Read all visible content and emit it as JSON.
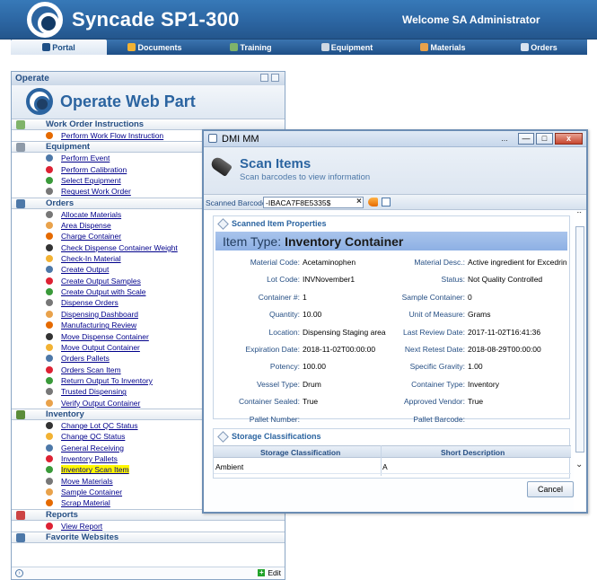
{
  "header": {
    "app_title": "Syncade SP1-300",
    "welcome": "Welcome SA Administrator"
  },
  "nav": {
    "items": [
      {
        "label": "Portal",
        "icon": "portal-icon",
        "color": "#1e4f86"
      },
      {
        "label": "Documents",
        "icon": "folder-icon",
        "color": "#f2b233"
      },
      {
        "label": "Training",
        "icon": "training-icon",
        "color": "#7fb36a"
      },
      {
        "label": "Equipment",
        "icon": "gear-icon",
        "color": "#cfd8e3"
      },
      {
        "label": "Materials",
        "icon": "materials-icon",
        "color": "#e9a24b"
      },
      {
        "label": "Orders",
        "icon": "orders-icon",
        "color": "#d9e3f0"
      }
    ]
  },
  "webpart": {
    "title": "Operate",
    "banner": "Operate Web Part",
    "sections": [
      {
        "title": "Work Order Instructions",
        "items": [
          "Perform Work Flow Instruction"
        ]
      },
      {
        "title": "Equipment",
        "items": [
          "Perform Event",
          "Perform Calibration",
          "Select Equipment",
          "Request Work Order"
        ]
      },
      {
        "title": "Orders",
        "items": [
          "Allocate Materials",
          "Area Dispense",
          "Charge Container",
          "Check Dispense Container Weight",
          "Check-In Material",
          "Create Output",
          "Create Output Samples",
          "Create Output with Scale",
          "Dispense Orders",
          "Dispensing Dashboard",
          "Manufacturing Review",
          "Move Dispense Container",
          "Move Output Container",
          "Orders Pallets",
          "Orders Scan Item",
          "Return Output To Inventory",
          "Trusted Dispensing",
          "Verify Output Container"
        ]
      },
      {
        "title": "Inventory",
        "items": [
          "Change Lot QC Status",
          "Change QC Status",
          "General Receiving",
          "Inventory Pallets",
          "Inventory Scan Item",
          "Move Materials",
          "Sample Container",
          "Scrap Material"
        ]
      },
      {
        "title": "Reports",
        "items": [
          "View Report"
        ]
      },
      {
        "title": "Favorite Websites",
        "items": []
      }
    ],
    "edit_label": "Edit"
  },
  "dialog": {
    "window_title": "DMI MM",
    "heading": "Scan Items",
    "subheading": "Scan barcodes to view information",
    "barcode_label": "Scanned Barcode:",
    "barcode_value": "-IBACA7F8E5335$",
    "props_header": "Scanned Item Properties",
    "item_type_label": "Item Type:",
    "item_type_value": "Inventory Container",
    "props_left": [
      {
        "label": "Material Code:",
        "value": "Acetaminophen"
      },
      {
        "label": "Lot Code:",
        "value": "INVNovember1"
      },
      {
        "label": "Container #:",
        "value": "1"
      },
      {
        "label": "Quantity:",
        "value": "10.00"
      },
      {
        "label": "Location:",
        "value": "Dispensing Staging area"
      },
      {
        "label": "Expiration Date:",
        "value": "2018-11-02T00:00:00"
      },
      {
        "label": "Potency:",
        "value": "100.00"
      },
      {
        "label": "Vessel Type:",
        "value": "Drum"
      },
      {
        "label": "Container Sealed:",
        "value": "True"
      },
      {
        "label": "Pallet Number:",
        "value": ""
      }
    ],
    "props_right": [
      {
        "label": "Material Desc.:",
        "value": "Active ingredient for Excedrin"
      },
      {
        "label": "Status:",
        "value": "Not Quality Controlled"
      },
      {
        "label": "Sample Container:",
        "value": "0"
      },
      {
        "label": "Unit of Measure:",
        "value": "Grams"
      },
      {
        "label": "Last Review Date:",
        "value": "2017-11-02T16:41:36"
      },
      {
        "label": "Next Retest Date:",
        "value": "2018-08-29T00:00:00"
      },
      {
        "label": "Specific Gravity:",
        "value": "1.00"
      },
      {
        "label": "Container Type:",
        "value": "Inventory"
      },
      {
        "label": "Approved Vendor:",
        "value": "True"
      },
      {
        "label": "Pallet Barcode:",
        "value": ""
      }
    ],
    "storage_header": "Storage Classifications",
    "table_columns": [
      "Storage Classification",
      "Short Description"
    ],
    "table_rows": [
      [
        "Ambient",
        "A"
      ]
    ],
    "cancel_label": "Cancel"
  }
}
